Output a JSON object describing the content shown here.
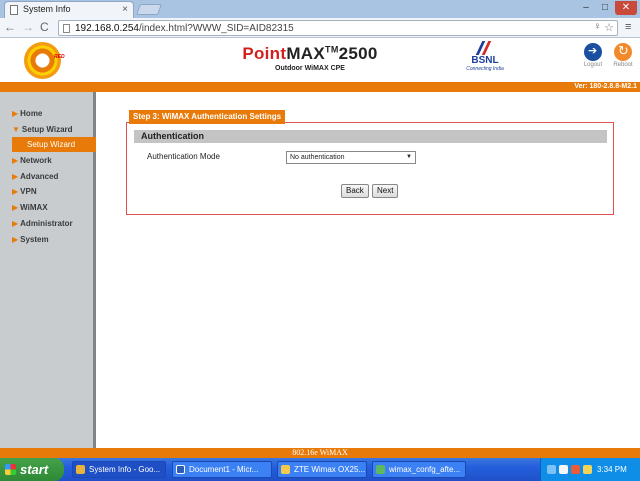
{
  "browser": {
    "tab_title": "System Info",
    "tab_close": "×",
    "url_host": "192.168.0.254",
    "url_path": "/index.html?WWW_SID=AID82315",
    "minimize": "–",
    "maximize": "□",
    "close": "✕",
    "back": "←",
    "forward": "→",
    "reload": "C",
    "key": "♀",
    "star": "☆",
    "menu": "≡"
  },
  "header": {
    "logo_text": "RED",
    "product_name_1": "Point",
    "product_name_2": "MAX",
    "product_tm": "TM",
    "product_name_3": "2500",
    "product_sub": "Outdoor WiMAX CPE",
    "partner_name": "BSNL",
    "partner_tag": "Connecting India",
    "logout_label": "Logout",
    "reboot_label": "Reboot",
    "version": "Ver: 180-2.8.8-M2.1"
  },
  "sidebar": {
    "arrow": "▶",
    "arrow_open": "▼",
    "items": [
      {
        "label": "Home"
      },
      {
        "label": "Setup Wizard"
      },
      {
        "label": "Network"
      },
      {
        "label": "Advanced"
      },
      {
        "label": "VPN"
      },
      {
        "label": "WiMAX"
      },
      {
        "label": "Administrator"
      },
      {
        "label": "System"
      }
    ],
    "sub_item": "Setup Wizard"
  },
  "main": {
    "step_title": "Step 3: WiMAX Authentication Settings",
    "section_title": "Authentication",
    "field_label": "Authentication Mode",
    "field_value": "No authentication",
    "caret": "▼",
    "back_label": "Back",
    "next_label": "Next"
  },
  "footer": {
    "text": "802.16e WiMAX"
  },
  "taskbar": {
    "start": "start",
    "tasks": [
      {
        "label": "System Info - Goo..."
      },
      {
        "label": "Document1 - Micr..."
      },
      {
        "label": "ZTE Wimax OX25..."
      },
      {
        "label": "wimax_confg_afte..."
      }
    ],
    "clock": "3:34 PM"
  },
  "colors": {
    "accent": "#e87a0a",
    "sidebar_bg": "#c8cccf",
    "panel_border": "#e05050"
  }
}
